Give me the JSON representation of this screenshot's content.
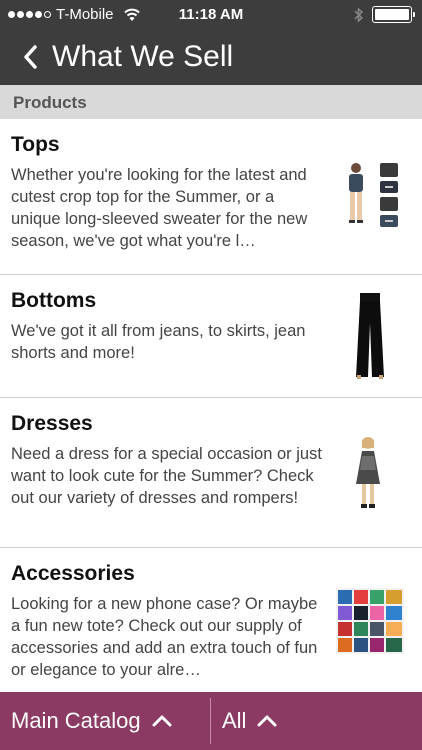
{
  "status_bar": {
    "carrier": "T-Mobile",
    "time": "11:18 AM"
  },
  "nav": {
    "title": "What We Sell"
  },
  "section": {
    "label": "Products"
  },
  "products": [
    {
      "title": "Tops",
      "description": "Whether you're looking for the latest and cutest crop top for the Summer, or a unique long-sleeved sweater for the new season, we've got what you're l…"
    },
    {
      "title": "Bottoms",
      "description": "We've got it all from jeans, to skirts, jean shorts and more!"
    },
    {
      "title": "Dresses",
      "description": "Need a dress for a special occasion or just want to look cute for the Summer? Check out our variety of dresses and rompers!"
    },
    {
      "title": "Accessories",
      "description": "Looking for a new phone case? Or maybe a fun new tote? Check out our supply of accessories and add an extra touch of fun or elegance to your alre…"
    }
  ],
  "bottom_bar": {
    "left_label": "Main Catalog",
    "right_label": "All"
  },
  "colors": {
    "header": "#3d3d3d",
    "section": "#d9d9d9",
    "bottom_bar": "#8b3a63"
  }
}
